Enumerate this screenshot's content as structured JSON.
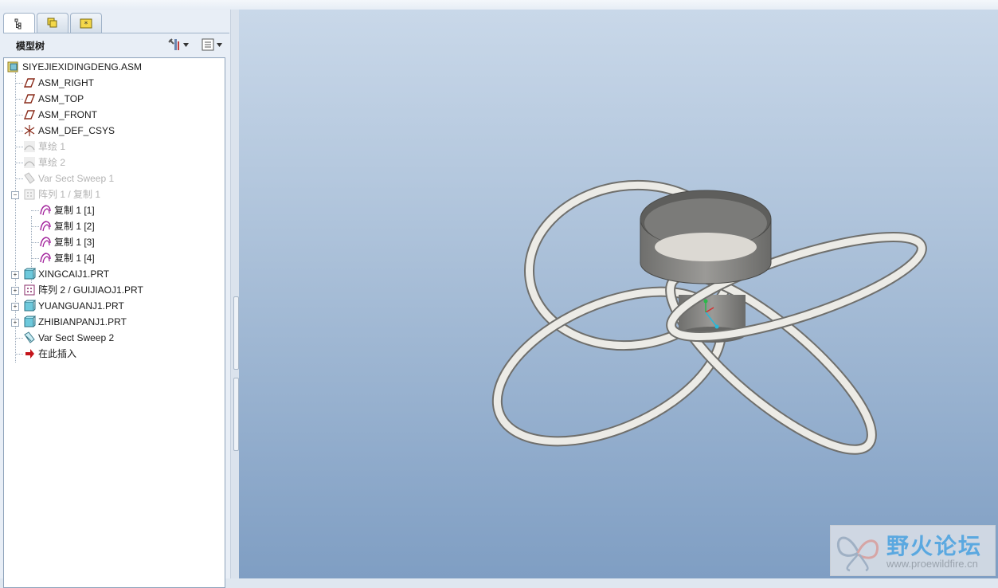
{
  "window": {
    "top_strip": ""
  },
  "panel": {
    "tabs": [
      {
        "icon": "model-tree-icon"
      },
      {
        "icon": "layers-icon"
      },
      {
        "icon": "favorites-folder-icon"
      }
    ],
    "title": "模型树",
    "tools_icon": "settings-tools-icon",
    "show_icon": "tree-show-icon"
  },
  "tree": {
    "root": "SIYEJIEXIDINGDENG.ASM",
    "items": [
      {
        "label": "ASM_RIGHT",
        "icon": "datum-plane-icon",
        "dim": false
      },
      {
        "label": "ASM_TOP",
        "icon": "datum-plane-icon",
        "dim": false
      },
      {
        "label": "ASM_FRONT",
        "icon": "datum-plane-icon",
        "dim": false
      },
      {
        "label": "ASM_DEF_CSYS",
        "icon": "coordinate-system-icon",
        "dim": false
      },
      {
        "label": "草绘 1",
        "icon": "sketch-icon",
        "dim": true
      },
      {
        "label": "草绘 2",
        "icon": "sketch-icon",
        "dim": true
      },
      {
        "label": "Var Sect Sweep 1",
        "icon": "sweep-icon",
        "dim": true
      },
      {
        "label": "阵列 1 / 复制 1",
        "icon": "pattern-icon",
        "dim": true
      },
      {
        "label": "复制 1 [1]",
        "icon": "copy-icon",
        "dim": false
      },
      {
        "label": "复制 1 [2]",
        "icon": "copy-icon",
        "dim": false
      },
      {
        "label": "复制 1 [3]",
        "icon": "copy-icon",
        "dim": false
      },
      {
        "label": "复制 1 [4]",
        "icon": "copy-icon",
        "dim": false
      },
      {
        "label": "XINGCAIJ1.PRT",
        "icon": "part-icon",
        "dim": false
      },
      {
        "label": "阵列 2 / GUIJIAOJ1.PRT",
        "icon": "pattern-icon",
        "dim": false
      },
      {
        "label": "YUANGUANJ1.PRT",
        "icon": "part-icon",
        "dim": false
      },
      {
        "label": "ZHIBIANPANJ1.PRT",
        "icon": "part-icon",
        "dim": false
      },
      {
        "label": "Var Sect Sweep 2",
        "icon": "sweep-icon",
        "dim": false
      },
      {
        "label": "在此插入",
        "icon": "insert-arrow-icon",
        "dim": false
      }
    ]
  },
  "watermark": {
    "cn": "野火论坛",
    "url": "www.proewildfire.cn"
  },
  "colors": {
    "viewport_top": "#c9d8e9",
    "viewport_bottom": "#7f9ec3",
    "model_surface": "#e8e6e0",
    "model_shade": "#8a8a88"
  }
}
